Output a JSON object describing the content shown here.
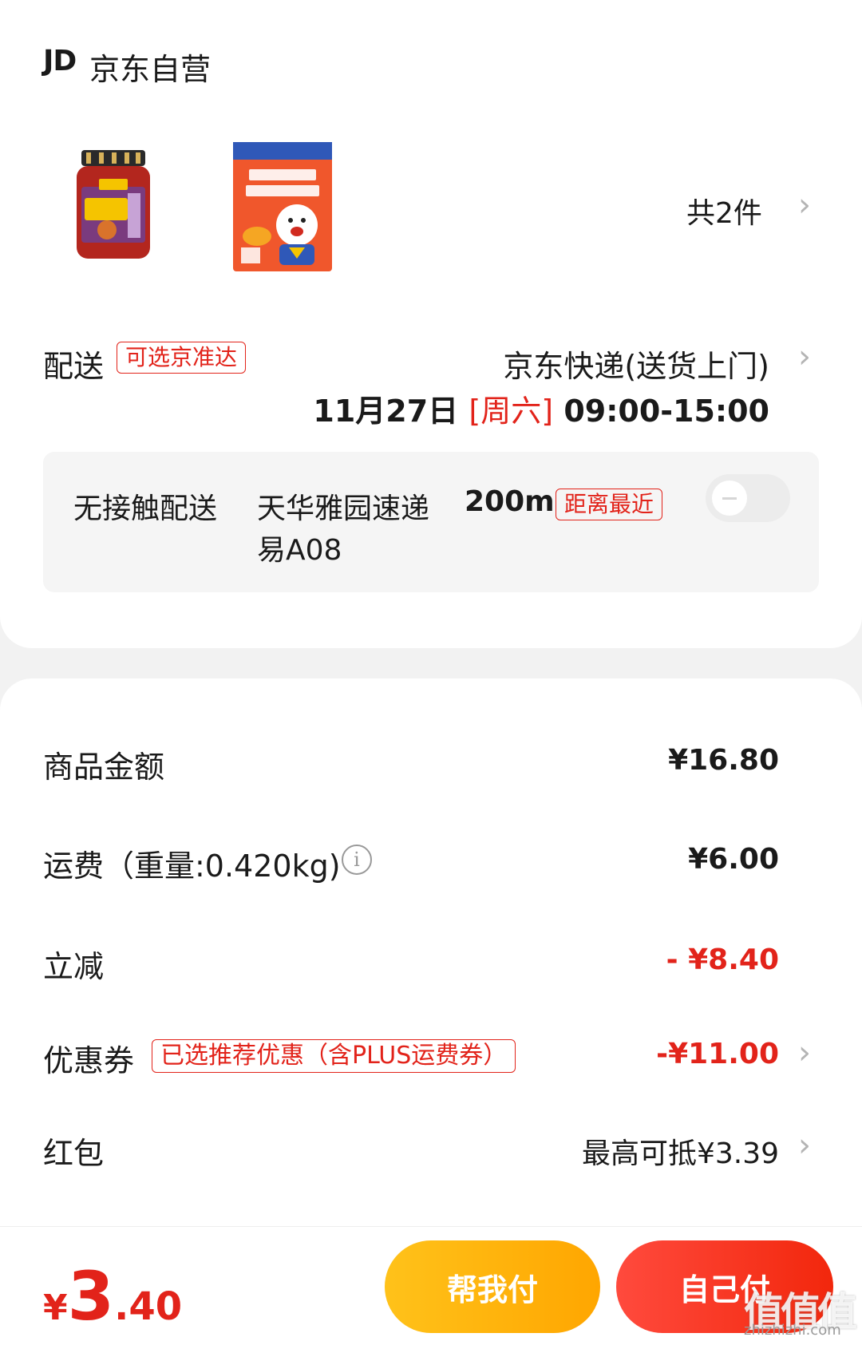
{
  "store": {
    "logo": "JD",
    "name": "京东自营"
  },
  "products": {
    "jar_icon": "jar-product-image",
    "bag_icon": "bag-product-image",
    "count_label": "共2件"
  },
  "delivery": {
    "label": "配送",
    "tag": "可选京准达",
    "method": "京东快递(送货上门)",
    "date": "11月27日",
    "weekday": "[周六]",
    "window": "09:00-15:00",
    "contactless_label": "无接触配送",
    "station": "天华雅园速递",
    "distance": "200m",
    "nearest_tag": "距离最近",
    "station_code": "易A08",
    "toggle_on": false
  },
  "pricing": {
    "goods_label": "商品金额",
    "goods_value": "¥16.80",
    "shipping_label": "运费（重量:0.420kg)",
    "shipping_value": "¥6.00",
    "discount_label": "立减",
    "discount_value": "- ¥8.40",
    "coupon_label": "优惠券",
    "coupon_tag": "已选推荐优惠（含PLUS运费券）",
    "coupon_value": "-¥11.00",
    "redpacket_label": "红包",
    "redpacket_value": "最高可抵¥3.39"
  },
  "footer": {
    "currency": "¥",
    "total_int": "3",
    "total_dec": ".40",
    "help_pay": "帮我付",
    "self_pay": "自己付"
  },
  "watermark": {
    "text": "值值值",
    "url": "zhizhizhi.com"
  },
  "colors": {
    "accent": "#e2231a",
    "help_button": "#ffb300",
    "pay_button": "#f2270c"
  }
}
